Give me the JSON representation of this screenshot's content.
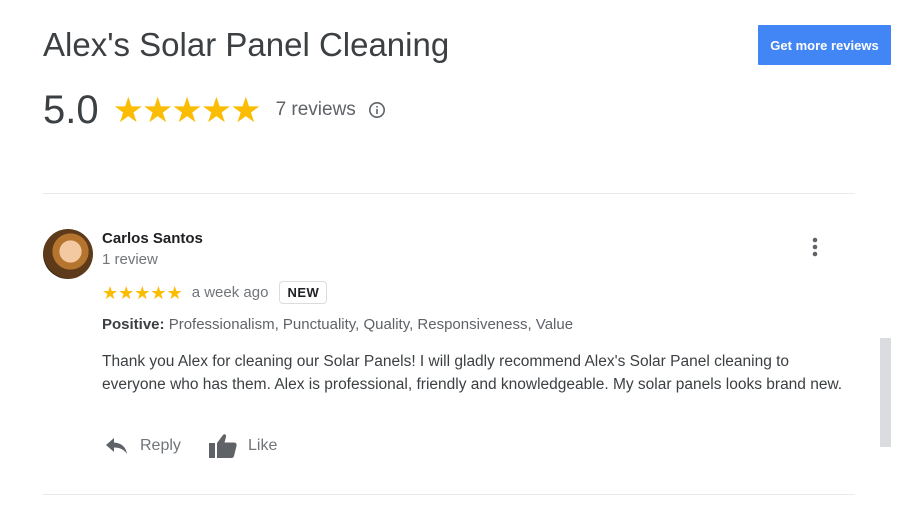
{
  "header": {
    "business_name": "Alex's Solar Panel Cleaning",
    "get_more_reviews_label": "Get more reviews",
    "rating_value": "5.0",
    "rating_stars": 5,
    "review_count_text": "7 reviews",
    "info_icon": "info-icon"
  },
  "review": {
    "reviewer_name": "Carlos Santos",
    "reviewer_review_count": "1 review",
    "stars": 5,
    "time_ago": "a week ago",
    "badge": "NEW",
    "positive_label": "Positive:",
    "positive_values": "Professionalism, Punctuality, Quality, Responsiveness, Value",
    "text": "Thank you Alex for cleaning our Solar Panels! I will gladly recommend Alex's Solar Panel cleaning to everyone who has them. Alex is professional, friendly and knowledgeable. My solar panels looks brand new.",
    "reply_label": "Reply",
    "like_label": "Like"
  },
  "colors": {
    "accent": "#4285f4",
    "star": "#fbbc04",
    "muted_text": "#70757a"
  }
}
